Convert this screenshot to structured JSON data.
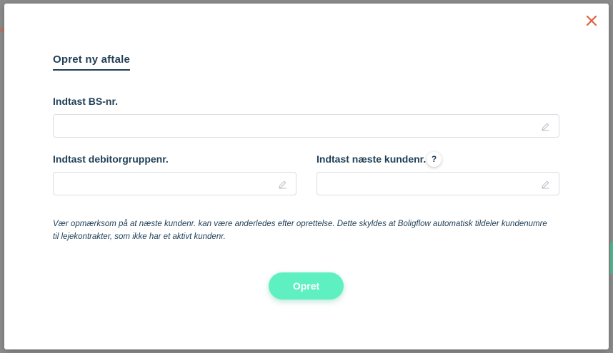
{
  "modal": {
    "title": "Opret ny aftale",
    "close_icon": "close-icon",
    "colors": {
      "title": "#1f3e56",
      "close": "#e0603f",
      "button": "#5ef0c0"
    }
  },
  "form": {
    "bs_number": {
      "label": "Indtast BS-nr.",
      "value": "",
      "icon": "pencil-icon"
    },
    "debtor_group": {
      "label": "Indtast debitorgruppenr.",
      "value": "",
      "icon": "pencil-icon"
    },
    "next_customer": {
      "label": "Indtast næste kundenr.",
      "value": "",
      "icon": "pencil-icon",
      "help": "?"
    },
    "note": "Vær opmærksom på at næste kundenr. kan være anderledes efter oprettelse. Dette skyldes at Boligflow automatisk tildeler kundenumre til lejekontrakter, som ikke har et aktivt kundenr.",
    "submit_label": "Opret"
  }
}
